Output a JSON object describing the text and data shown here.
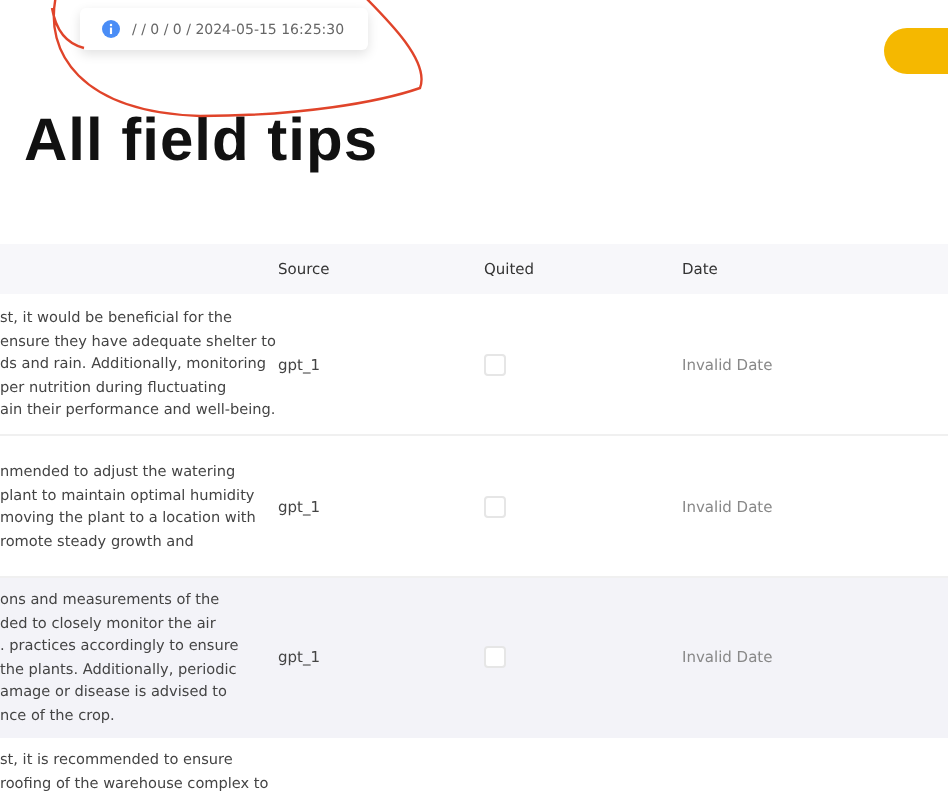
{
  "toast": {
    "message": "/ / 0 / 0 / 2024-05-15 16:25:30"
  },
  "title": "All field tips",
  "table": {
    "columns": [
      "Source",
      "Quited",
      "Date"
    ],
    "rows": [
      {
        "lines": [
          "st, it would be beneficial for the",
          "ensure they have adequate shelter to",
          "ds and rain. Additionally, monitoring",
          "per nutrition during fluctuating",
          "ain their performance and well-being."
        ],
        "source": "gpt_1",
        "quited": false,
        "date": "Invalid Date",
        "selected": false
      },
      {
        "lines": [
          "nmended to adjust the watering",
          "plant to maintain optimal humidity",
          "moving the plant to a location with",
          "romote steady growth and"
        ],
        "source": "gpt_1",
        "quited": false,
        "date": "Invalid Date",
        "selected": false
      },
      {
        "lines": [
          "ons and measurements of the",
          "ded to closely monitor the air",
          ". practices accordingly to ensure",
          "the plants. Additionally, periodic",
          "amage or disease is advised to",
          "nce of the crop."
        ],
        "source": "gpt_1",
        "quited": false,
        "date": "Invalid Date",
        "selected": true
      },
      {
        "lines": [
          "st, it is recommended to ensure",
          "roofing of the warehouse complex to"
        ],
        "selected": false
      }
    ]
  }
}
